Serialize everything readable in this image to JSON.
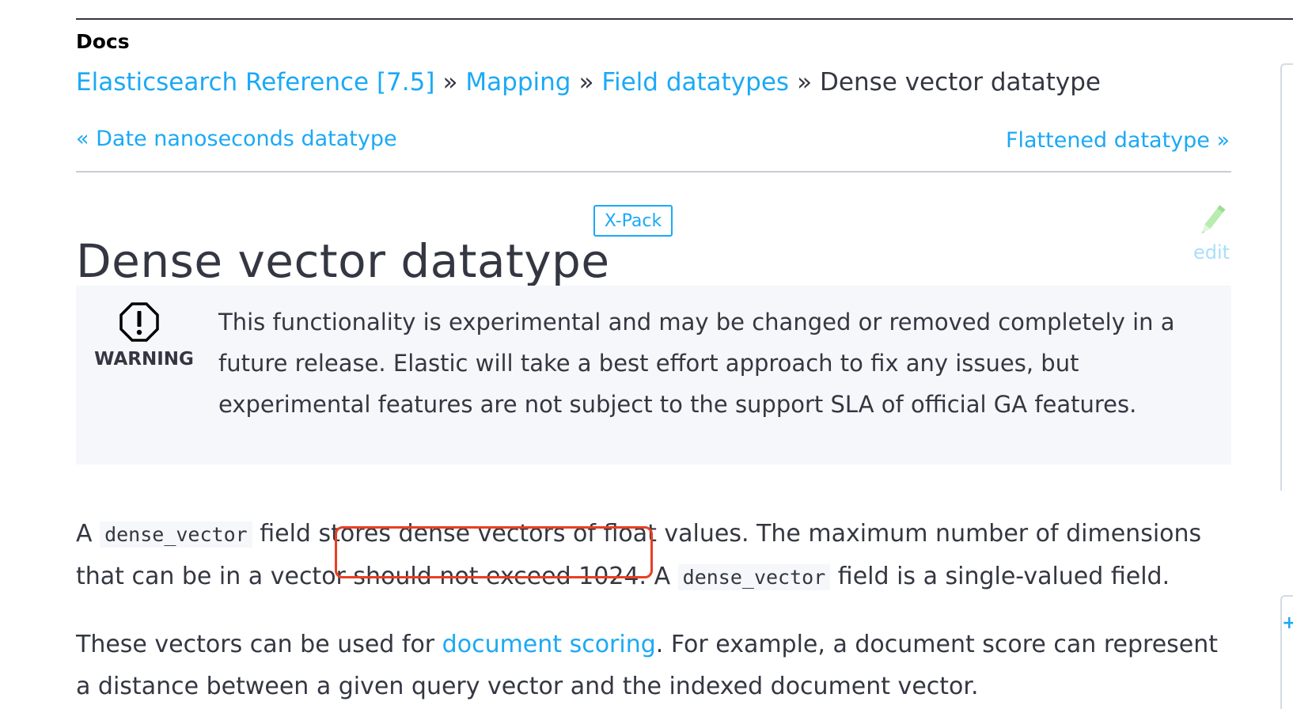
{
  "header": {
    "docs_label": "Docs"
  },
  "breadcrumb": {
    "items": [
      {
        "label": "Elasticsearch Reference [7.5]"
      },
      {
        "label": "Mapping"
      },
      {
        "label": "Field datatypes"
      }
    ],
    "separator": "»",
    "current": "Dense vector datatype"
  },
  "navigation": {
    "previous": "« Date nanoseconds datatype",
    "next": "Flattened datatype »"
  },
  "page": {
    "title": "Dense vector datatype",
    "badge": "X-Pack",
    "edit_label": "edit",
    "edit_icon": "pencil-icon"
  },
  "warning": {
    "icon": "warning-octagon-icon",
    "label": "WARNING",
    "text": "This functionality is experimental and may be changed or removed completely in a future release. Elastic will take a best effort approach to fix any issues, but experimental features are not subject to the support SLA of official GA features."
  },
  "paragraph1": {
    "start": "A ",
    "code1": "dense_vector",
    "middle": " field stores dense vectors of float values. The maximum number of dimensions that can be in a vector should not exceed 1024. A ",
    "code2": "dense_vector",
    "end": " field is a single-valued field."
  },
  "paragraph2": {
    "start": "These vectors can be used for ",
    "link": "document scoring",
    "end": ". For example, a document score can represent a distance between a given query vector and the indexed document vector."
  },
  "colors": {
    "link": "#1ba9f5",
    "text": "#343741",
    "highlight": "#ea3e23",
    "warning_background": "#f5f7fa"
  }
}
